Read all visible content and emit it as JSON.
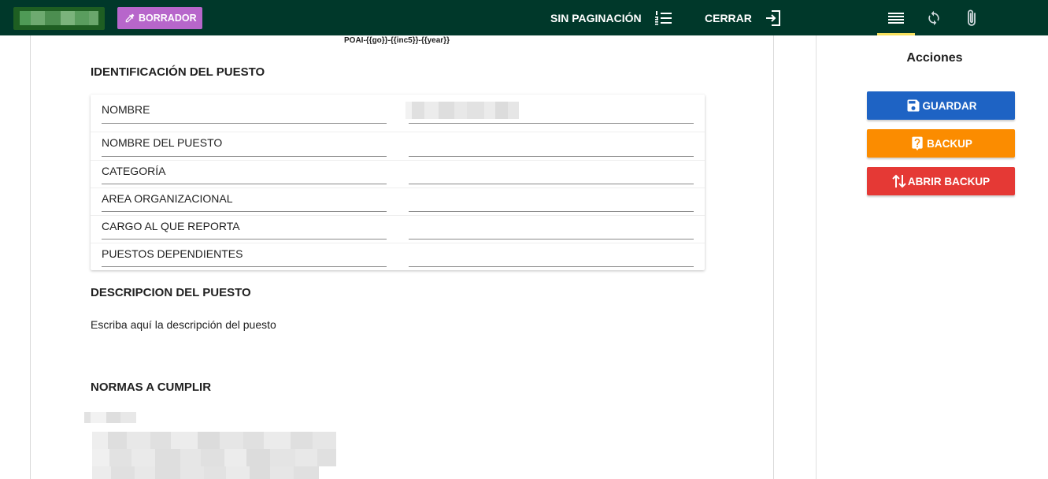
{
  "topbar": {
    "draft_label": "BORRADOR",
    "no_pagination_label": "SIN PAGINACIÓN",
    "close_label": "CERRAR",
    "icons": {
      "draft": "eyedropper-icon",
      "no_pagination": "list-numbered-icon",
      "close": "exit-icon"
    }
  },
  "side_tabs": [
    {
      "icon": "menu-lines-icon",
      "active": true
    },
    {
      "icon": "sync-icon",
      "active": false
    },
    {
      "icon": "paperclip-icon",
      "active": false
    }
  ],
  "document": {
    "code": "POAI-{{go}}-{{inc5}}-{{year}}",
    "identification_title": "IDENTIFICACIÓN DEL PUESTO",
    "fields": [
      {
        "label": "NOMBRE"
      },
      {
        "label": "NOMBRE DEL PUESTO"
      },
      {
        "label": "CATEGORÍA"
      },
      {
        "label": "AREA ORGANIZACIONAL"
      },
      {
        "label": "CARGO AL QUE REPORTA"
      },
      {
        "label": "PUESTOS DEPENDIENTES"
      }
    ],
    "description_title": "DESCRIPCION DEL PUESTO",
    "description_text": "Escriba aquí la descripción del puesto",
    "normas_title": "NORMAS A CUMPLIR"
  },
  "panel": {
    "title": "Acciones",
    "save_label": "GUARDAR",
    "backup_label": "BACKUP",
    "open_backup_label": "ABRIR BACKUP"
  },
  "colors": {
    "topbar": "#00382a",
    "draft": "#b766cb",
    "save": "#1e63c4",
    "backup": "#fb8c00",
    "open_backup": "#e53935",
    "active_tab": "#f6e05e"
  }
}
